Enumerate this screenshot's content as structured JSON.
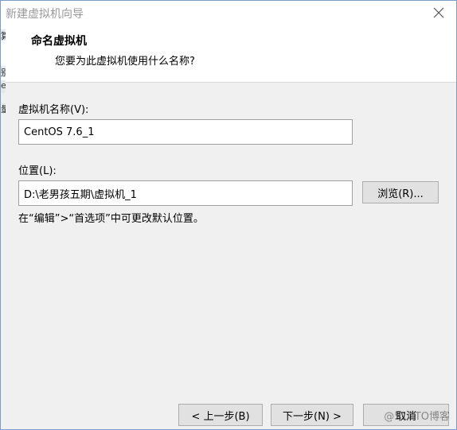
{
  "window": {
    "title": "新建虚拟机向导"
  },
  "header": {
    "title": "命名虚拟机",
    "subtitle": "您要为此虚拟机使用什么名称?"
  },
  "form": {
    "name_label": "虚拟机名称(V):",
    "name_value": "CentOS 7.6_1",
    "location_label": "位置(L):",
    "location_value": "D:\\老男孩五期\\虚拟机_1",
    "browse_label": "浏览(R)...",
    "hint": "在“编辑”>“首选项”中可更改默认位置。"
  },
  "footer": {
    "back_label": "< 上一步(B)",
    "next_label": "下一步(N) >",
    "cancel_label": "取消"
  },
  "background_fragments": [
    "算",
    "别",
    "e",
    "量"
  ],
  "watermark": "@51CTO博客",
  "icons": {
    "close": "close-icon"
  }
}
